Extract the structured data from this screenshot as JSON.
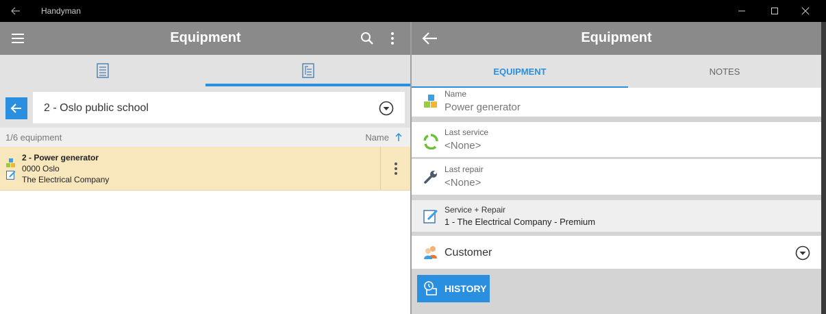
{
  "window": {
    "title": "Handyman"
  },
  "left": {
    "title": "Equipment",
    "filter": {
      "selected": "2 - Oslo public school"
    },
    "list": {
      "count": "1/6 equipment",
      "sort_label": "Name",
      "items": [
        {
          "line1": "2 - Power generator",
          "line2": "0000 Oslo",
          "line3": "The Electrical Company"
        }
      ]
    }
  },
  "right": {
    "title": "Equipment",
    "tabs": [
      {
        "label": "EQUIPMENT"
      },
      {
        "label": "NOTES"
      }
    ],
    "fields": {
      "name": {
        "label": "Name",
        "value": "Power generator"
      },
      "last_service": {
        "label": "Last service",
        "value": "<None>"
      },
      "last_repair": {
        "label": "Last repair",
        "value": "<None>"
      },
      "service_repair": {
        "label": "Service + Repair",
        "value": "1 - The Electrical Company  - Premium"
      },
      "customer": {
        "label": "Customer"
      }
    },
    "history_button": "HISTORY"
  },
  "colors": {
    "accent": "#2b8fe0",
    "appbar": "#8a8a8a",
    "highlight_row": "#f8e6bd"
  },
  "icons": {
    "back": "arrow-left-icon",
    "menu": "hamburger-icon",
    "search": "search-icon",
    "more": "more-vertical-icon",
    "list_view": "list-icon",
    "tree_view": "tree-list-icon",
    "dropdown": "chevron-down-circle-icon",
    "sort": "arrow-up-icon",
    "equipment": "boxes-icon",
    "edit": "edit-document-icon",
    "service": "recycle-icon",
    "repair": "wrench-icon",
    "customer": "people-icon",
    "history": "history-icon"
  }
}
